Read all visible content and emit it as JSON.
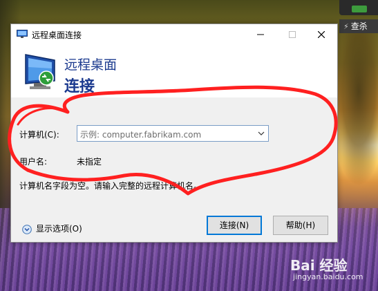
{
  "desktop": {
    "tray_button_label": "查杀",
    "watermark_main": "Bai 经验",
    "watermark_sub": "jingyan.baidu.com"
  },
  "dialog": {
    "window_title": "远程桌面连接",
    "header_line1": "远程桌面",
    "header_line2": "连接",
    "computer_label": "计算机(C):",
    "computer_placeholder": "示例: computer.fabrikam.com",
    "user_label": "用户名:",
    "user_value": "未指定",
    "message": "计算机名字段为空。请输入完整的远程计算机名。",
    "show_options_label": "显示选项(O)",
    "connect_button": "连接(N)",
    "help_button": "帮助(H)"
  },
  "colors": {
    "header_text": "#1b3a8f",
    "annotation": "#ff2020",
    "primary_border": "#0078d7"
  },
  "icons": [
    "remote-desktop-app-icon",
    "minimize-icon",
    "maximize-icon",
    "close-icon",
    "monitor-icon",
    "chevron-down-icon",
    "expand-options-icon",
    "lightning-icon"
  ]
}
